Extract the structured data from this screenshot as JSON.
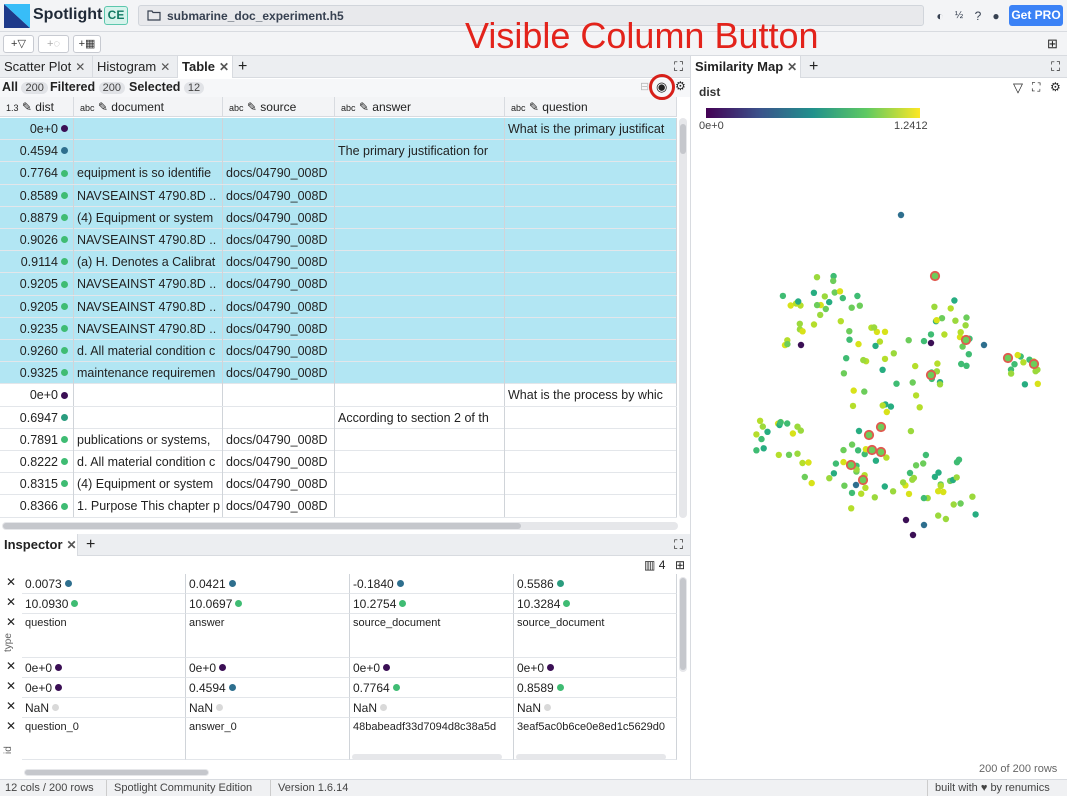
{
  "app": {
    "name": "Spotlight",
    "edition_badge": "CE",
    "file_name": "submarine_doc_experiment.h5",
    "get_pro_label": "Get PRO"
  },
  "annotation": {
    "text": "Visible Column Button"
  },
  "left_tabs": [
    {
      "label": "Scatter Plot"
    },
    {
      "label": "Histogram"
    },
    {
      "label": "Table"
    }
  ],
  "right_tabs": [
    {
      "label": "Similarity Map"
    }
  ],
  "filter_bar": {
    "all_label": "All",
    "all_count": "200",
    "filtered_label": "Filtered",
    "filtered_count": "200",
    "selected_label": "Selected",
    "selected_count": "12"
  },
  "table": {
    "columns": [
      {
        "type_icon": "1.3",
        "label": "dist"
      },
      {
        "type_icon": "abc",
        "label": "document"
      },
      {
        "type_icon": "abc",
        "label": "source"
      },
      {
        "type_icon": "abc",
        "label": "answer"
      },
      {
        "type_icon": "abc",
        "label": "question"
      }
    ],
    "rows": [
      {
        "dist": "0e+0",
        "dot": "#3b0f55",
        "document": "",
        "source": "",
        "answer": "",
        "question": "What is the primary justificat",
        "selected": true
      },
      {
        "dist": "0.4594",
        "dot": "#2e6f8e",
        "document": "",
        "source": "",
        "answer": "The primary justification for",
        "question": "",
        "selected": true
      },
      {
        "dist": "0.7764",
        "dot": "#3fbc73",
        "document": "equipment is so identifie",
        "source": "docs/04790_008D",
        "answer": "",
        "question": "",
        "selected": true
      },
      {
        "dist": "0.8589",
        "dot": "#3fbc73",
        "document": "NAVSEAINST 4790.8D ..",
        "source": "docs/04790_008D",
        "answer": "",
        "question": "",
        "selected": true
      },
      {
        "dist": "0.8879",
        "dot": "#3fbc73",
        "document": "(4) Equipment or system",
        "source": "docs/04790_008D",
        "answer": "",
        "question": "",
        "selected": true
      },
      {
        "dist": "0.9026",
        "dot": "#3fbc73",
        "document": "NAVSEAINST 4790.8D ..",
        "source": "docs/04790_008D",
        "answer": "",
        "question": "",
        "selected": true
      },
      {
        "dist": "0.9114",
        "dot": "#3fbc73",
        "document": "(a) H. Denotes a Calibrat",
        "source": "docs/04790_008D",
        "answer": "",
        "question": "",
        "selected": true
      },
      {
        "dist": "0.9205",
        "dot": "#3fbc73",
        "document": "NAVSEAINST 4790.8D ..",
        "source": "docs/04790_008D",
        "answer": "",
        "question": "",
        "selected": true
      },
      {
        "dist": "0.9205",
        "dot": "#3fbc73",
        "document": "NAVSEAINST 4790.8D ..",
        "source": "docs/04790_008D",
        "answer": "",
        "question": "",
        "selected": true
      },
      {
        "dist": "0.9235",
        "dot": "#3fbc73",
        "document": "NAVSEAINST 4790.8D ..",
        "source": "docs/04790_008D",
        "answer": "",
        "question": "",
        "selected": true
      },
      {
        "dist": "0.9260",
        "dot": "#3fbc73",
        "document": "d. All material condition c",
        "source": "docs/04790_008D",
        "answer": "",
        "question": "",
        "selected": true
      },
      {
        "dist": "0.9325",
        "dot": "#3fbc73",
        "document": "maintenance requiremen",
        "source": "docs/04790_008D",
        "answer": "",
        "question": "",
        "selected": true
      },
      {
        "dist": "0e+0",
        "dot": "#3b0f55",
        "document": "",
        "source": "",
        "answer": "",
        "question": "What is the process by whic",
        "selected": false
      },
      {
        "dist": "0.6947",
        "dot": "#2a9c7e",
        "document": "",
        "source": "",
        "answer": "According to section 2 of th",
        "question": "",
        "selected": false
      },
      {
        "dist": "0.7891",
        "dot": "#3fbc73",
        "document": "publications or systems,",
        "source": "docs/04790_008D",
        "answer": "",
        "question": "",
        "selected": false
      },
      {
        "dist": "0.8222",
        "dot": "#3fbc73",
        "document": "d. All material condition c",
        "source": "docs/04790_008D",
        "answer": "",
        "question": "",
        "selected": false
      },
      {
        "dist": "0.8315",
        "dot": "#3fbc73",
        "document": "(4) Equipment or system",
        "source": "docs/04790_008D",
        "answer": "",
        "question": "",
        "selected": false
      },
      {
        "dist": "0.8366",
        "dot": "#3fbc73",
        "document": "1. Purpose This chapter p",
        "source": "docs/04790_008D",
        "answer": "",
        "question": "",
        "selected": false
      }
    ]
  },
  "inspector": {
    "tab_label": "Inspector",
    "column_count": "4",
    "type_label": "type",
    "id_label": "id",
    "rows": [
      {
        "cells": [
          {
            "text": "0.0073",
            "dot": "#2e6f8e"
          },
          {
            "text": "0.0421",
            "dot": "#2e6f8e"
          },
          {
            "text": "-0.1840",
            "dot": "#2e6f8e"
          },
          {
            "text": "0.5586",
            "dot": "#2a9c7e"
          }
        ]
      },
      {
        "cells": [
          {
            "text": "10.0930",
            "dot": "#3fbc73"
          },
          {
            "text": "10.0697",
            "dot": "#3fbc73"
          },
          {
            "text": "10.2754",
            "dot": "#3fbc73"
          },
          {
            "text": "10.3284",
            "dot": "#3fbc73"
          }
        ]
      },
      {
        "cells": [
          {
            "text": "question",
            "dot": ""
          },
          {
            "text": "answer",
            "dot": ""
          },
          {
            "text": "source_document",
            "dot": ""
          },
          {
            "text": "source_document",
            "dot": ""
          }
        ]
      },
      {
        "cells": [
          {
            "text": "0e+0",
            "dot": "#3b0f55"
          },
          {
            "text": "0e+0",
            "dot": "#3b0f55"
          },
          {
            "text": "0e+0",
            "dot": "#3b0f55"
          },
          {
            "text": "0e+0",
            "dot": "#3b0f55"
          }
        ]
      },
      {
        "cells": [
          {
            "text": "0e+0",
            "dot": "#3b0f55"
          },
          {
            "text": "0.4594",
            "dot": "#2e6f8e"
          },
          {
            "text": "0.7764",
            "dot": "#3fbc73"
          },
          {
            "text": "0.8589",
            "dot": "#3fbc73"
          }
        ]
      },
      {
        "cells": [
          {
            "text": "NaN",
            "dot": "#d9d9d9"
          },
          {
            "text": "NaN",
            "dot": "#d9d9d9"
          },
          {
            "text": "NaN",
            "dot": "#d9d9d9"
          },
          {
            "text": "NaN",
            "dot": "#d9d9d9"
          }
        ]
      },
      {
        "cells": [
          {
            "text": "question_0",
            "dot": ""
          },
          {
            "text": "answer_0",
            "dot": ""
          },
          {
            "text": "48babeadf33d7094d8c38a5d",
            "dot": ""
          },
          {
            "text": "3eaf5ac0b6ce0e8ed1c5629d0",
            "dot": ""
          }
        ]
      }
    ]
  },
  "similarity_map": {
    "color_label": "dist",
    "scale_min": "0e+0",
    "scale_max": "1.2412",
    "row_counter": "200 of 200 rows"
  },
  "status_bar": {
    "cols_rows": "12 cols / 200 rows",
    "edition": "Spotlight Community Edition",
    "version": "Version 1.6.14",
    "built_with": "built with ♥ by renumics"
  },
  "colors": {
    "selected_row": "#b2e6f3",
    "accent": "#3b82f6",
    "annotation_red": "#e3231b"
  }
}
